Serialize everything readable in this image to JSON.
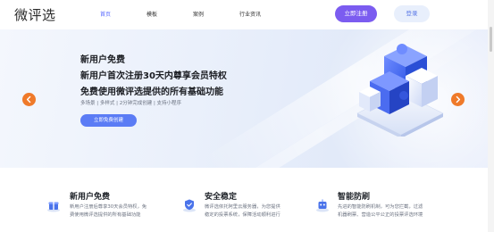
{
  "header": {
    "logo": "微评选",
    "nav": [
      {
        "label": "首页",
        "active": true
      },
      {
        "label": "模板",
        "active": false
      },
      {
        "label": "案例",
        "active": false
      },
      {
        "label": "行业资讯",
        "active": false
      }
    ],
    "register_label": "立即注册",
    "login_label": "登录"
  },
  "banner": {
    "line1": "新用户免费",
    "line2": "新用户首次注册30天内尊享会员特权",
    "line3": "免费使用微评选提供的所有基础功能",
    "subtitle": "多场景 | 多样式 | 2分钟完成创建 | 支持小程序",
    "cta_label": "立即免费创建",
    "accent": "#ef7a2a"
  },
  "features": [
    {
      "title": "新用户免费",
      "desc1": "新用户注册后尊享30天会员特权，免",
      "desc2": "费使用微评选提供的所有基础功能",
      "icon": "gift-icon"
    },
    {
      "title": "安全稳定",
      "desc1": "微评选依托阿里云服务器，为您提供",
      "desc2": "稳定的投票系统，保障活动顺利进行",
      "icon": "shield-icon"
    },
    {
      "title": "智能防刷",
      "desc1": "先进的智能防刷机制，可为您拦截，过滤",
      "desc2": "机器刷票、营造公平公正的投票评选环境",
      "icon": "robot-icon"
    }
  ]
}
